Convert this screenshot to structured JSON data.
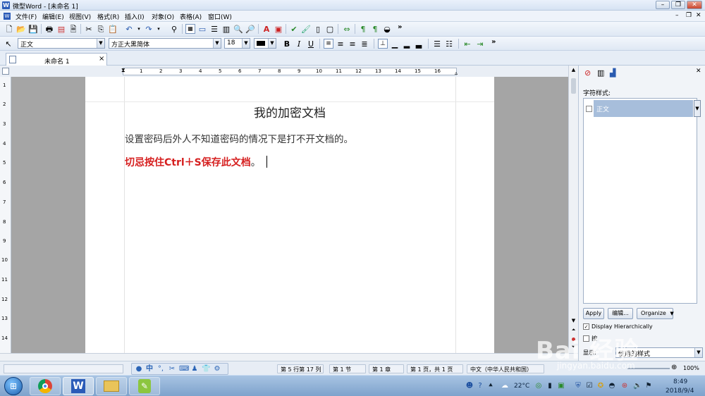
{
  "window": {
    "app_icon": "W",
    "title": "微型Word - [未命名 1]",
    "controls": [
      "minimize-icon",
      "restore-icon",
      "close-icon"
    ]
  },
  "menu": [
    "文件(F)",
    "编辑(E)",
    "视图(V)",
    "格式(R)",
    "插入(I)",
    "对象(O)",
    "表格(A)",
    "窗口(W)"
  ],
  "toolbar1": {
    "overflow": "»"
  },
  "format_bar": {
    "style": "正文",
    "font": "方正大黑简体",
    "size": "18",
    "overflow": "»"
  },
  "tabs": [
    {
      "label": "未命名 1",
      "close": "×"
    }
  ],
  "ruler": {
    "numbers": [
      "1",
      "2",
      "3",
      "4",
      "5",
      "6",
      "7",
      "8",
      "9",
      "10",
      "11",
      "12",
      "13",
      "14",
      "15",
      "16"
    ]
  },
  "vruler": {
    "numbers": [
      "1",
      "2",
      "3",
      "4",
      "5",
      "6",
      "7",
      "8",
      "9",
      "10",
      "11",
      "12",
      "13",
      "14"
    ]
  },
  "document": {
    "title": "我的加密文档",
    "line1": "设置密码后外人不知道密码的情况下是打不开文档的。",
    "line2_strong": "切忌按住Ctrl＋S保存此文档",
    "line2_tail": "。",
    "colors": {
      "title": "#222222",
      "body": "#333333",
      "strong": "#d62020"
    }
  },
  "panel": {
    "heading": "字符样式:",
    "selected_style": "正文",
    "buttons": {
      "apply": "Apply",
      "edit": "编辑...",
      "organize": "Organize"
    },
    "display_hierarchically": "Display Hierarchically",
    "checkbox2": "按",
    "show_label": "显示:",
    "show_value": "使用的样式"
  },
  "status": {
    "position": "第 5 行第 17 列",
    "section": "第 1 节",
    "chapter": "第 1 章",
    "page": "第 1 页，共 1 页",
    "language": "中文（中华人民共和国）",
    "zoom_left": "",
    "zoom": "100%"
  },
  "ime": {
    "lang": "中"
  },
  "taskbar": {
    "temperature": "22°C",
    "time": "8:49",
    "date": "2018/9/4"
  },
  "watermark": {
    "text": "Bai 经验",
    "url": "jingyan.baidu.com"
  }
}
